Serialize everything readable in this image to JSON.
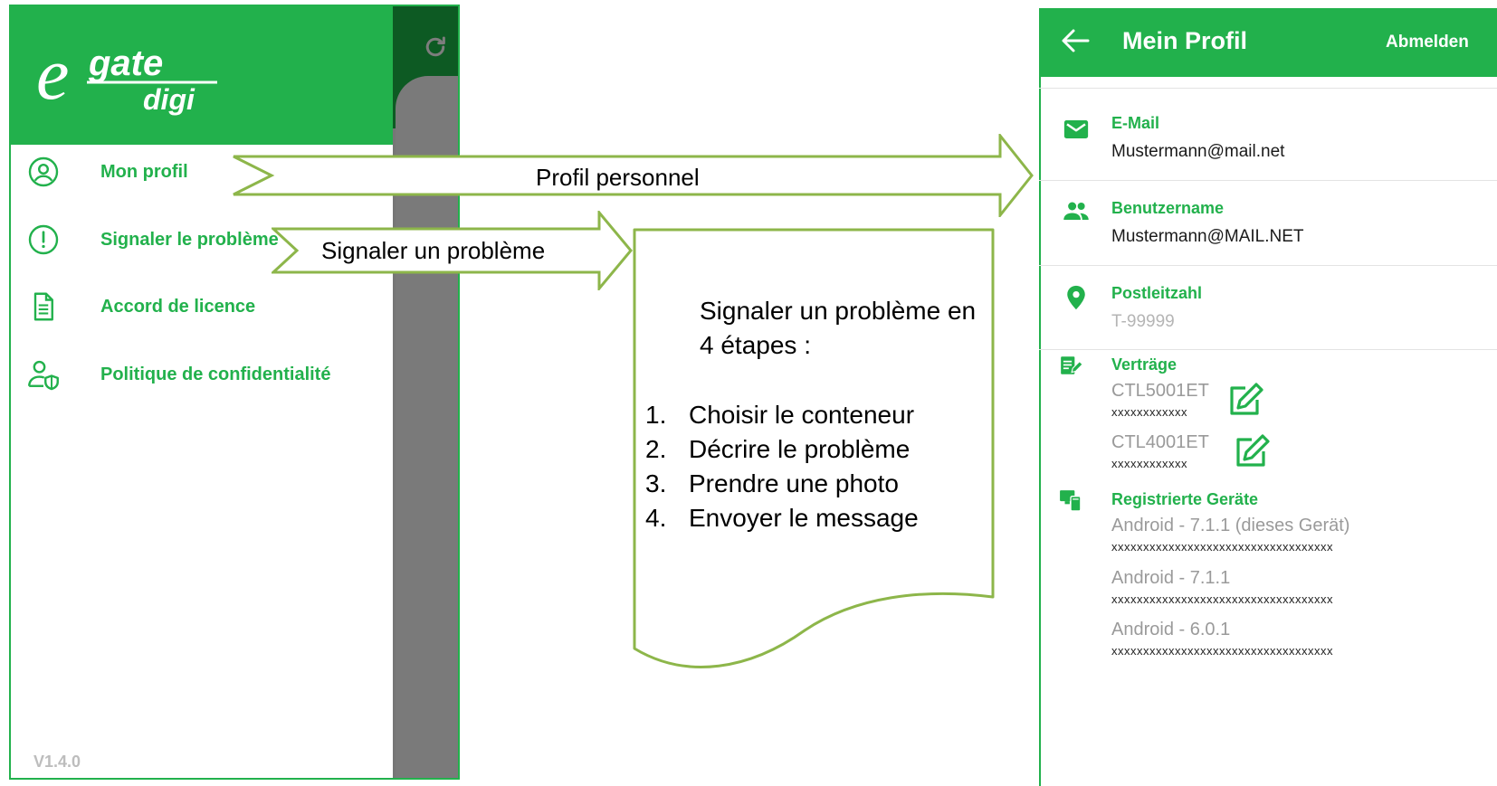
{
  "colors": {
    "brand_green": "#22b14c",
    "arrow_green": "#8db64a",
    "scrim": "#767676"
  },
  "drawer": {
    "logo": {
      "line1": "gate",
      "line2": "digi",
      "initial": "e"
    },
    "items": [
      {
        "label": "Mon profil",
        "icon": "user-circle-icon"
      },
      {
        "label": "Signaler le problème",
        "icon": "exclamation-circle-icon"
      },
      {
        "label": "Accord de licence",
        "icon": "document-icon"
      },
      {
        "label": "Politique de confidentialité",
        "icon": "user-shield-icon"
      }
    ],
    "version": "V1.4.0",
    "refresh_icon": "refresh-icon"
  },
  "annotations": {
    "profile_arrow": "Profil personnel",
    "report_arrow": "Signaler un problème",
    "note": {
      "heading": "Signaler un problème en 4 étapes :",
      "steps": [
        {
          "num": "1.",
          "text": "Choisir le conteneur"
        },
        {
          "num": "2.",
          "text": "Décrire le problème"
        },
        {
          "num": "3.",
          "text": "Prendre une photo"
        },
        {
          "num": "4.",
          "text": "Envoyer le message"
        }
      ]
    }
  },
  "profile": {
    "title": "Mein Profil",
    "logout": "Abmelden",
    "fields": {
      "email": {
        "label": "E-Mail",
        "value": "Mustermann@mail.net",
        "icon": "mail-icon"
      },
      "username": {
        "label": "Benutzername",
        "value": "Mustermann@MAIL.NET",
        "icon": "users-icon"
      },
      "postcode": {
        "label": "Postleitzahl",
        "value": "T-99999",
        "icon": "location-pin-icon"
      }
    },
    "contracts": {
      "label": "Verträge",
      "icon": "contract-edit-icon",
      "items": [
        {
          "code": "CTL5001ET",
          "sub": "xxxxxxxxxxxx"
        },
        {
          "code": "CTL4001ET",
          "sub": "xxxxxxxxxxxx"
        }
      ]
    },
    "devices": {
      "label": "Registrierte Geräte",
      "icon": "devices-icon",
      "items": [
        {
          "name": "Android - 7.1.1 (dieses Gerät)",
          "id": "xxxxxxxxxxxxxxxxxxxxxxxxxxxxxxxxxxx"
        },
        {
          "name": "Android - 7.1.1",
          "id": "xxxxxxxxxxxxxxxxxxxxxxxxxxxxxxxxxxx"
        },
        {
          "name": "Android - 6.0.1",
          "id": "xxxxxxxxxxxxxxxxxxxxxxxxxxxxxxxxxxx"
        }
      ]
    }
  }
}
